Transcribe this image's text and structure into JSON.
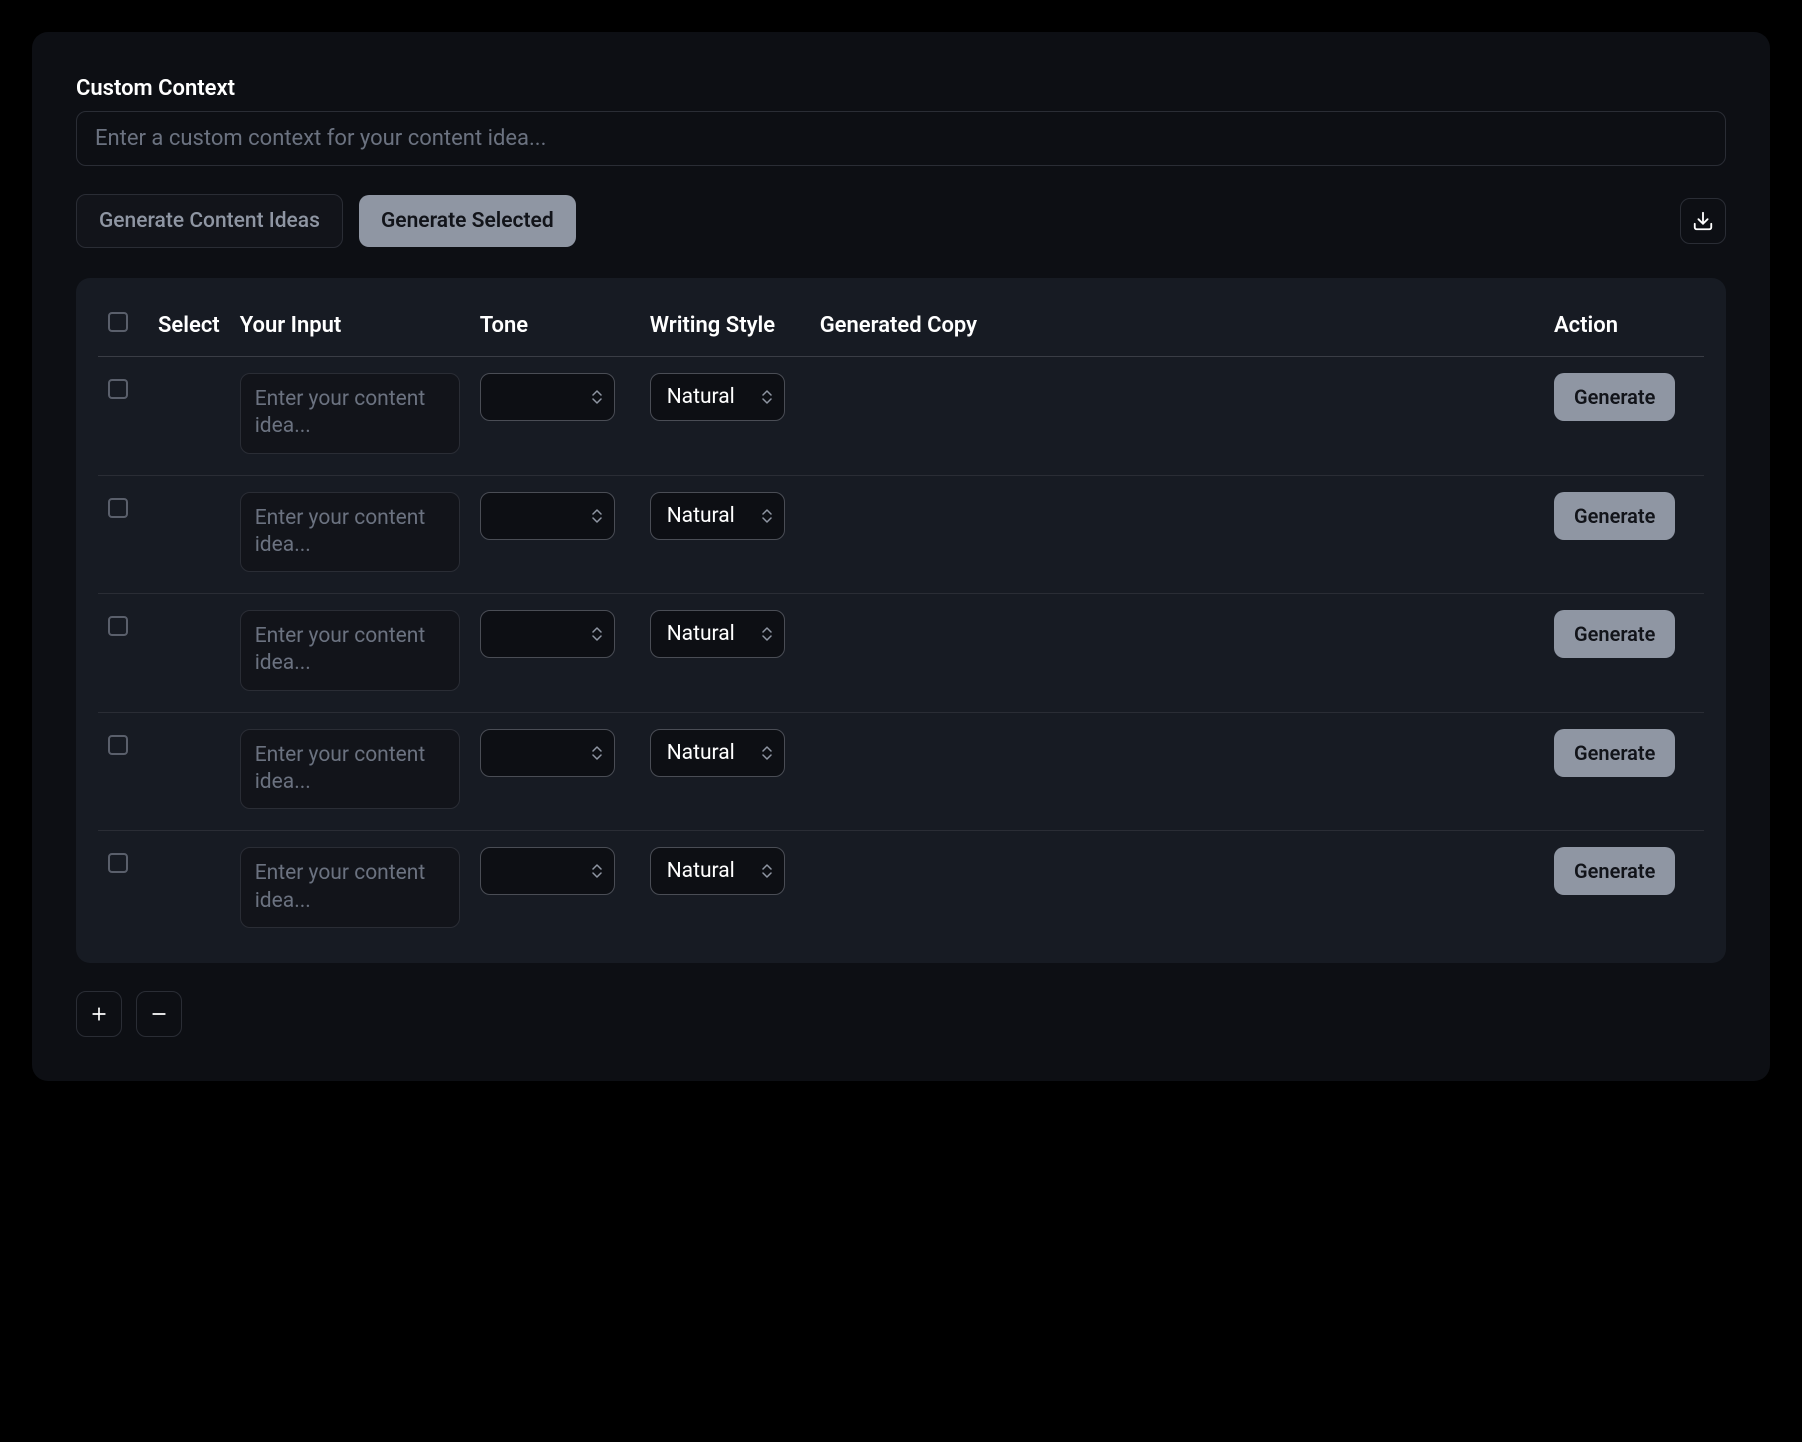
{
  "header": {
    "context_label": "Custom Context",
    "context_placeholder": "Enter a custom context for your content idea..."
  },
  "actions": {
    "generate_ideas_label": "Generate Content Ideas",
    "generate_selected_label": "Generate Selected"
  },
  "table": {
    "headers": {
      "select": "Select",
      "input": "Your Input",
      "tone": "Tone",
      "style": "Writing Style",
      "copy": "Generated Copy",
      "action": "Action"
    },
    "row_defaults": {
      "input_placeholder": "Enter your content idea...",
      "tone_value": "",
      "style_value": "Natural",
      "action_label": "Generate"
    },
    "rows": [
      {
        "input_placeholder": "Enter your content idea...",
        "tone_value": "",
        "style_value": "Natural",
        "action_label": "Generate"
      },
      {
        "input_placeholder": "Enter your content idea...",
        "tone_value": "",
        "style_value": "Natural",
        "action_label": "Generate"
      },
      {
        "input_placeholder": "Enter your content idea...",
        "tone_value": "",
        "style_value": "Natural",
        "action_label": "Generate"
      },
      {
        "input_placeholder": "Enter your content idea...",
        "tone_value": "",
        "style_value": "Natural",
        "action_label": "Generate"
      },
      {
        "input_placeholder": "Enter your content idea...",
        "tone_value": "",
        "style_value": "Natural",
        "action_label": "Generate"
      }
    ]
  }
}
